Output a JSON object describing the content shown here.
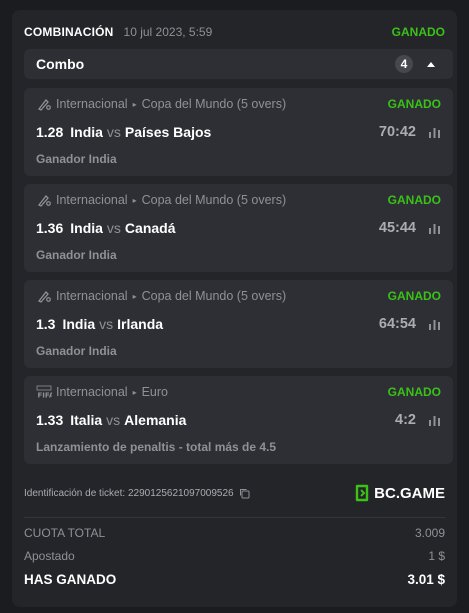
{
  "header": {
    "type": "COMBINACIÓN",
    "date": "10 jul 2023, 5:59",
    "status": "GANADO"
  },
  "combo": {
    "label": "Combo",
    "count": "4"
  },
  "bets": [
    {
      "sport_icon": "cricket-icon",
      "category": "Internacional",
      "league": "Copa del Mundo (5 overs)",
      "status": "GANADO",
      "odds": "1.28",
      "home": "India",
      "vs": "vs",
      "away": "Países Bajos",
      "score": "70:42",
      "selection": "Ganador India"
    },
    {
      "sport_icon": "cricket-icon",
      "category": "Internacional",
      "league": "Copa del Mundo (5 overs)",
      "status": "GANADO",
      "odds": "1.36",
      "home": "India",
      "vs": "vs",
      "away": "Canadá",
      "score": "45:44",
      "selection": "Ganador India"
    },
    {
      "sport_icon": "cricket-icon",
      "category": "Internacional",
      "league": "Copa del Mundo (5 overs)",
      "status": "GANADO",
      "odds": "1.3",
      "home": "India",
      "vs": "vs",
      "away": "Irlanda",
      "score": "64:54",
      "selection": "Ganador India"
    },
    {
      "sport_icon": "penalty-fifa-icon",
      "category": "Internacional",
      "league": "Euro",
      "status": "GANADO",
      "odds": "1.33",
      "home": "Italia",
      "vs": "vs",
      "away": "Alemania",
      "score": "4:2",
      "selection": "Lanzamiento de penaltis - total más de 4.5"
    }
  ],
  "ticket": {
    "id_text": "Identificación de ticket: 2290125621097009526",
    "brand": "BC.GAME"
  },
  "summary": {
    "total_odds_label": "CUOTA TOTAL",
    "total_odds_value": "3.009",
    "staked_label": "Apostado",
    "staked_value": "1 $",
    "won_label": "HAS GANADO",
    "won_value": "3.01 $"
  },
  "colors": {
    "win": "#3bc117",
    "background": "#1b1c1f",
    "card": "#232529",
    "item": "#2d2f34"
  }
}
